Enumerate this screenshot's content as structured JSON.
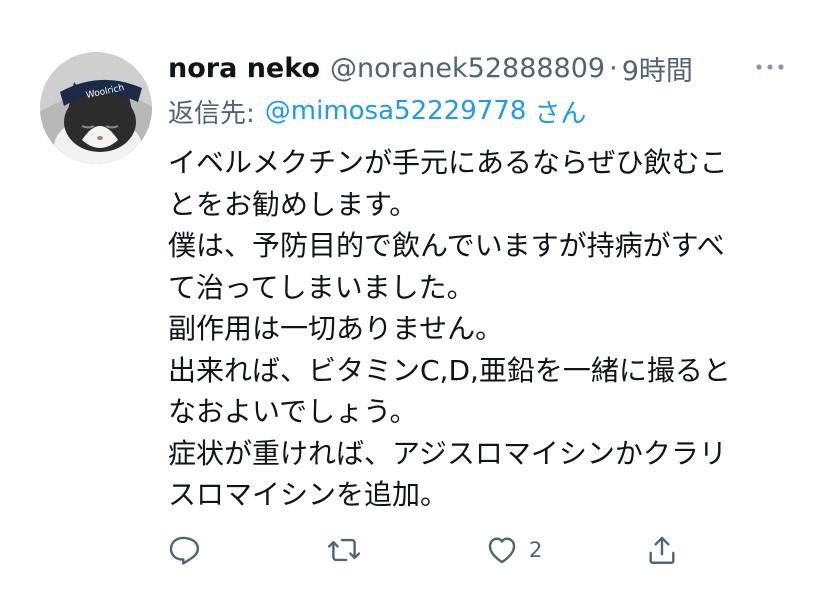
{
  "tweet": {
    "display_name": "nora neko",
    "handle": "@noranek52888809",
    "separator": "·",
    "time": "9時間",
    "reply_label": "返信先:",
    "reply_to": "@mimosa52229778",
    "reply_suffix": "さん",
    "body_lines": [
      "イベルメクチンが手元にあるならぜひ飲むこ",
      "とをお勧めします。",
      "僕は、予防目的で飲んでいますが持病がすべ",
      "て治ってしまいました。",
      "副作用は一切ありません。",
      "出来れば、ビタミンC,D,亜鉛を一緒に撮ると",
      "なおよいでしょう。",
      "症状が重ければ、アジスロマイシンかクラリ",
      "スロマイシンを追加。"
    ],
    "like_count": "2"
  },
  "avatar": {
    "logo_text": "Woolrich"
  },
  "icons": {
    "more": "more-horizontal-icon",
    "reply": "reply-icon",
    "retweet": "retweet-icon",
    "like": "heart-icon",
    "share": "share-icon"
  },
  "colors": {
    "text": "#0f1419",
    "secondary": "#536471",
    "link": "#1d9bf0",
    "background": "#ffffff"
  }
}
